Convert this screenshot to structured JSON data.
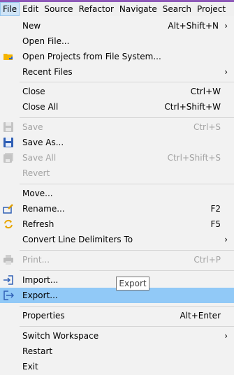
{
  "menubar": {
    "items": [
      {
        "label": "File"
      },
      {
        "label": "Edit"
      },
      {
        "label": "Source"
      },
      {
        "label": "Refactor"
      },
      {
        "label": "Navigate"
      },
      {
        "label": "Search"
      },
      {
        "label": "Project"
      }
    ]
  },
  "menu": {
    "new": {
      "label": "New",
      "shortcut": "Alt+Shift+N"
    },
    "open_file": {
      "label": "Open File..."
    },
    "open_projects": {
      "label": "Open Projects from File System..."
    },
    "recent_files": {
      "label": "Recent Files"
    },
    "close": {
      "label": "Close",
      "shortcut": "Ctrl+W"
    },
    "close_all": {
      "label": "Close All",
      "shortcut": "Ctrl+Shift+W"
    },
    "save": {
      "label": "Save",
      "shortcut": "Ctrl+S"
    },
    "save_as": {
      "label": "Save As..."
    },
    "save_all": {
      "label": "Save All",
      "shortcut": "Ctrl+Shift+S"
    },
    "revert": {
      "label": "Revert"
    },
    "move": {
      "label": "Move..."
    },
    "rename": {
      "label": "Rename...",
      "shortcut": "F2"
    },
    "refresh": {
      "label": "Refresh",
      "shortcut": "F5"
    },
    "convert": {
      "label": "Convert Line Delimiters To"
    },
    "print": {
      "label": "Print...",
      "shortcut": "Ctrl+P"
    },
    "import": {
      "label": "Import..."
    },
    "export": {
      "label": "Export..."
    },
    "properties": {
      "label": "Properties",
      "shortcut": "Alt+Enter"
    },
    "switch_workspace": {
      "label": "Switch Workspace"
    },
    "restart": {
      "label": "Restart"
    },
    "exit": {
      "label": "Exit"
    },
    "submenu_arrow": "›"
  },
  "tooltip": {
    "text": "Export"
  },
  "colors": {
    "highlight": "#91c9f7",
    "disabled_text": "#a3a3a3",
    "top_strip": "#8d59b8"
  }
}
